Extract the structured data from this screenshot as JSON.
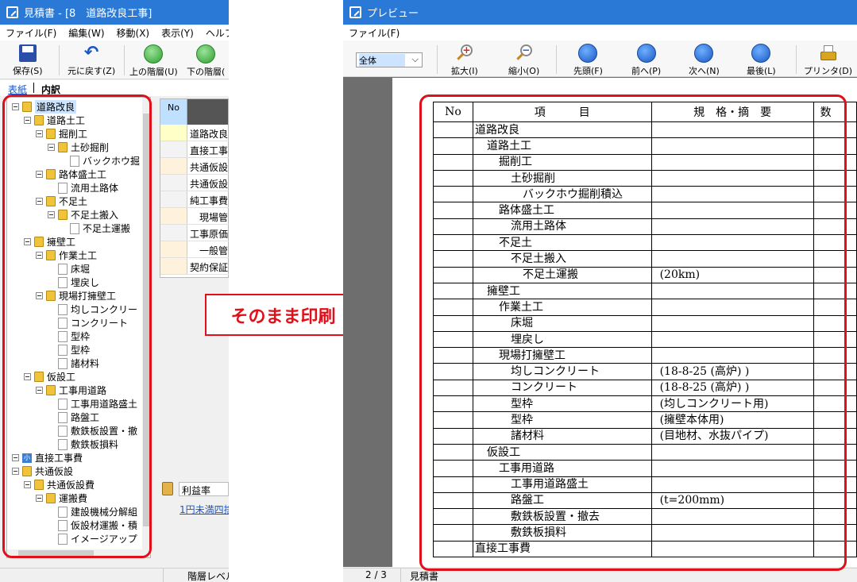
{
  "left": {
    "title": "見積書 - [8　道路改良工事]",
    "menu": [
      "ファイル(F)",
      "編集(W)",
      "移動(X)",
      "表示(Y)",
      "ヘルプ(Z)"
    ],
    "toolbar": {
      "save": "保存(S)",
      "undo": "元に戻す(Z)",
      "up": "上の階層(U)",
      "down": "下の階層("
    },
    "tabs": {
      "cover": "表紙",
      "detail": "内訳"
    },
    "tree": [
      {
        "label": "道路改良",
        "depth": 0,
        "type": "folder",
        "selected": true
      },
      {
        "label": "道路土工",
        "depth": 1,
        "type": "folder"
      },
      {
        "label": "掘削工",
        "depth": 2,
        "type": "folder"
      },
      {
        "label": "土砂掘削",
        "depth": 3,
        "type": "folder"
      },
      {
        "label": "バックホウ掘",
        "depth": 4,
        "type": "leaf"
      },
      {
        "label": "路体盛土工",
        "depth": 2,
        "type": "folder"
      },
      {
        "label": "流用土路体",
        "depth": 3,
        "type": "leaf"
      },
      {
        "label": "不足土",
        "depth": 2,
        "type": "folder"
      },
      {
        "label": "不足土搬入",
        "depth": 3,
        "type": "folder"
      },
      {
        "label": "不足土運搬",
        "depth": 4,
        "type": "leaf"
      },
      {
        "label": "擁壁工",
        "depth": 1,
        "type": "folder"
      },
      {
        "label": "作業土工",
        "depth": 2,
        "type": "folder"
      },
      {
        "label": "床堀",
        "depth": 3,
        "type": "leaf"
      },
      {
        "label": "埋戻し",
        "depth": 3,
        "type": "leaf"
      },
      {
        "label": "現場打擁壁工",
        "depth": 2,
        "type": "folder"
      },
      {
        "label": "均しコンクリー",
        "depth": 3,
        "type": "leaf"
      },
      {
        "label": "コンクリート",
        "depth": 3,
        "type": "leaf"
      },
      {
        "label": "型枠",
        "depth": 3,
        "type": "leaf"
      },
      {
        "label": "型枠",
        "depth": 3,
        "type": "leaf"
      },
      {
        "label": "諸材料",
        "depth": 3,
        "type": "leaf"
      },
      {
        "label": "仮設工",
        "depth": 1,
        "type": "folder"
      },
      {
        "label": "工事用道路",
        "depth": 2,
        "type": "folder"
      },
      {
        "label": "工事用道路盛土",
        "depth": 3,
        "type": "leaf"
      },
      {
        "label": "路盤工",
        "depth": 3,
        "type": "leaf"
      },
      {
        "label": "敷鉄板設置・撤",
        "depth": 3,
        "type": "leaf"
      },
      {
        "label": "敷鉄板損料",
        "depth": 3,
        "type": "leaf"
      },
      {
        "label": "直接工事費",
        "depth": 0,
        "type": "small"
      },
      {
        "label": "共通仮設",
        "depth": 0,
        "type": "folder"
      },
      {
        "label": "共通仮設費",
        "depth": 1,
        "type": "folder"
      },
      {
        "label": "運搬費",
        "depth": 2,
        "type": "folder"
      },
      {
        "label": "建設機械分解組",
        "depth": 3,
        "type": "leaf"
      },
      {
        "label": "仮設材運搬・積",
        "depth": 3,
        "type": "leaf"
      },
      {
        "label": "イメージアップ",
        "depth": 3,
        "type": "leaf"
      }
    ],
    "grid": {
      "header_no": "No",
      "rows": [
        "道路改良",
        "直接工事",
        "共通仮設",
        "共通仮設",
        "純工事費",
        "　現場管",
        "工事原価",
        "　一般管",
        "契約保証"
      ]
    },
    "profit_label": "利益率",
    "link_text": "1円未満四捨",
    "status": "階層レベル"
  },
  "callout": "そのまま印刷",
  "right": {
    "title": "プレビュー",
    "menu": [
      "ファイル(F)"
    ],
    "zoom_select": "全体",
    "toolbar": {
      "zoomin": "拡大(I)",
      "zoomout": "縮小(O)",
      "first": "先頭(F)",
      "prev": "前へ(P)",
      "next": "次へ(N)",
      "last": "最後(L)",
      "printer": "プリンタ(D)"
    },
    "table_header": {
      "no": "No",
      "item": "項　　　目",
      "spec": "規　格・摘　要",
      "more": "数"
    },
    "rows": [
      {
        "item": "道路改良",
        "indent": 0,
        "spec": ""
      },
      {
        "item": "道路土工",
        "indent": 1,
        "spec": ""
      },
      {
        "item": "掘削工",
        "indent": 2,
        "spec": ""
      },
      {
        "item": "土砂掘削",
        "indent": 3,
        "spec": ""
      },
      {
        "item": "バックホウ掘削積込",
        "indent": 4,
        "spec": ""
      },
      {
        "item": "路体盛土工",
        "indent": 2,
        "spec": ""
      },
      {
        "item": "流用土路体",
        "indent": 3,
        "spec": ""
      },
      {
        "item": "不足土",
        "indent": 2,
        "spec": ""
      },
      {
        "item": "不足土搬入",
        "indent": 3,
        "spec": ""
      },
      {
        "item": "不足土運搬",
        "indent": 4,
        "spec": "(20km)"
      },
      {
        "item": "擁壁工",
        "indent": 1,
        "spec": ""
      },
      {
        "item": "作業土工",
        "indent": 2,
        "spec": ""
      },
      {
        "item": "床堀",
        "indent": 3,
        "spec": ""
      },
      {
        "item": "埋戻し",
        "indent": 3,
        "spec": ""
      },
      {
        "item": "現場打擁壁工",
        "indent": 2,
        "spec": ""
      },
      {
        "item": "均しコンクリート",
        "indent": 3,
        "spec": "(18-8-25 (高炉) )"
      },
      {
        "item": "コンクリート",
        "indent": 3,
        "spec": "(18-8-25 (高炉) )"
      },
      {
        "item": "型枠",
        "indent": 3,
        "spec": "(均しコンクリート用)"
      },
      {
        "item": "型枠",
        "indent": 3,
        "spec": "(擁壁本体用)"
      },
      {
        "item": "諸材料",
        "indent": 3,
        "spec": "(目地材、水抜パイプ)"
      },
      {
        "item": "仮設工",
        "indent": 1,
        "spec": ""
      },
      {
        "item": "工事用道路",
        "indent": 2,
        "spec": ""
      },
      {
        "item": "工事用道路盛土",
        "indent": 3,
        "spec": ""
      },
      {
        "item": "路盤工",
        "indent": 3,
        "spec": "(t=200mm)"
      },
      {
        "item": "敷鉄板設置・撤去",
        "indent": 3,
        "spec": ""
      },
      {
        "item": "敷鉄板損料",
        "indent": 3,
        "spec": ""
      },
      {
        "item": "直接工事費",
        "indent": 0,
        "spec": ""
      }
    ],
    "status": {
      "page": "2 / 3",
      "doc": "見積書"
    }
  },
  "colors": {
    "accent_red": "#e0101a",
    "title_blue": "#2b79d6"
  }
}
